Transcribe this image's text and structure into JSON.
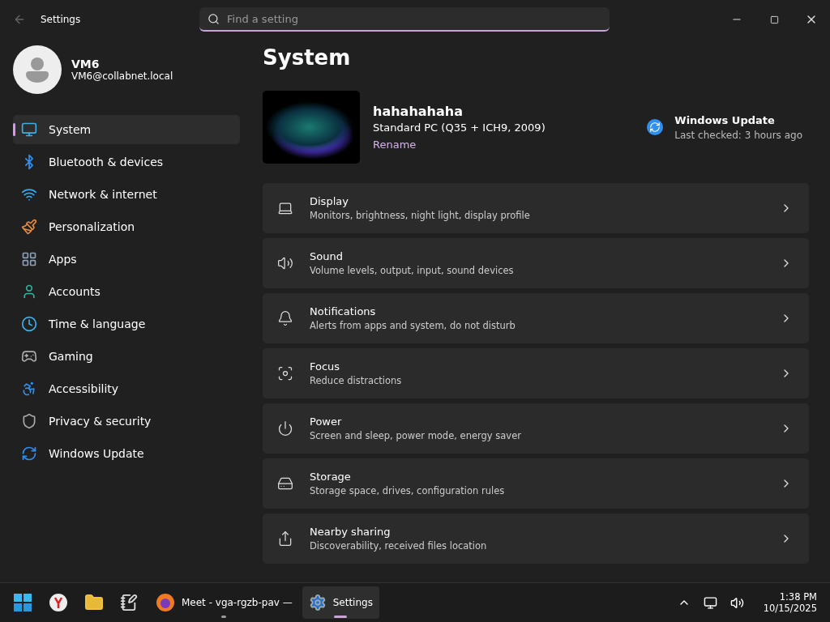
{
  "window": {
    "title": "Settings"
  },
  "search": {
    "placeholder": "Find a setting"
  },
  "user": {
    "name": "VM6",
    "email": "VM6@collabnet.local"
  },
  "sidebar": {
    "items": [
      {
        "label": "System",
        "selected": true
      },
      {
        "label": "Bluetooth & devices",
        "selected": false
      },
      {
        "label": "Network & internet",
        "selected": false
      },
      {
        "label": "Personalization",
        "selected": false
      },
      {
        "label": "Apps",
        "selected": false
      },
      {
        "label": "Accounts",
        "selected": false
      },
      {
        "label": "Time & language",
        "selected": false
      },
      {
        "label": "Gaming",
        "selected": false
      },
      {
        "label": "Accessibility",
        "selected": false
      },
      {
        "label": "Privacy & security",
        "selected": false
      },
      {
        "label": "Windows Update",
        "selected": false
      }
    ]
  },
  "page_title": "System",
  "device": {
    "name": "hahahahaha",
    "model": "Standard PC (Q35 + ICH9, 2009)",
    "rename_link": "Rename"
  },
  "update": {
    "title": "Windows Update",
    "status": "Last checked: 3 hours ago"
  },
  "settings": [
    {
      "title": "Display",
      "subtitle": "Monitors, brightness, night light, display profile"
    },
    {
      "title": "Sound",
      "subtitle": "Volume levels, output, input, sound devices"
    },
    {
      "title": "Notifications",
      "subtitle": "Alerts from apps and system, do not disturb"
    },
    {
      "title": "Focus",
      "subtitle": "Reduce distractions"
    },
    {
      "title": "Power",
      "subtitle": "Screen and sleep, power mode, energy saver"
    },
    {
      "title": "Storage",
      "subtitle": "Storage space, drives, configuration rules"
    },
    {
      "title": "Nearby sharing",
      "subtitle": "Discoverability, received files location"
    }
  ],
  "taskbar": {
    "apps": [
      {
        "kind": "start",
        "selected": false,
        "running": false
      },
      {
        "kind": "yandex",
        "selected": false,
        "running": false
      },
      {
        "kind": "explorer",
        "selected": false,
        "running": false
      },
      {
        "kind": "notepad",
        "selected": false,
        "running": false
      },
      {
        "kind": "firefox",
        "label": "Meet - vga-rgzb-pav —",
        "selected": false,
        "running": true
      },
      {
        "kind": "settings",
        "label": "Settings",
        "selected": true,
        "running": true
      }
    ],
    "clock": {
      "time": "1:38 PM",
      "date": "10/15/2025"
    }
  }
}
